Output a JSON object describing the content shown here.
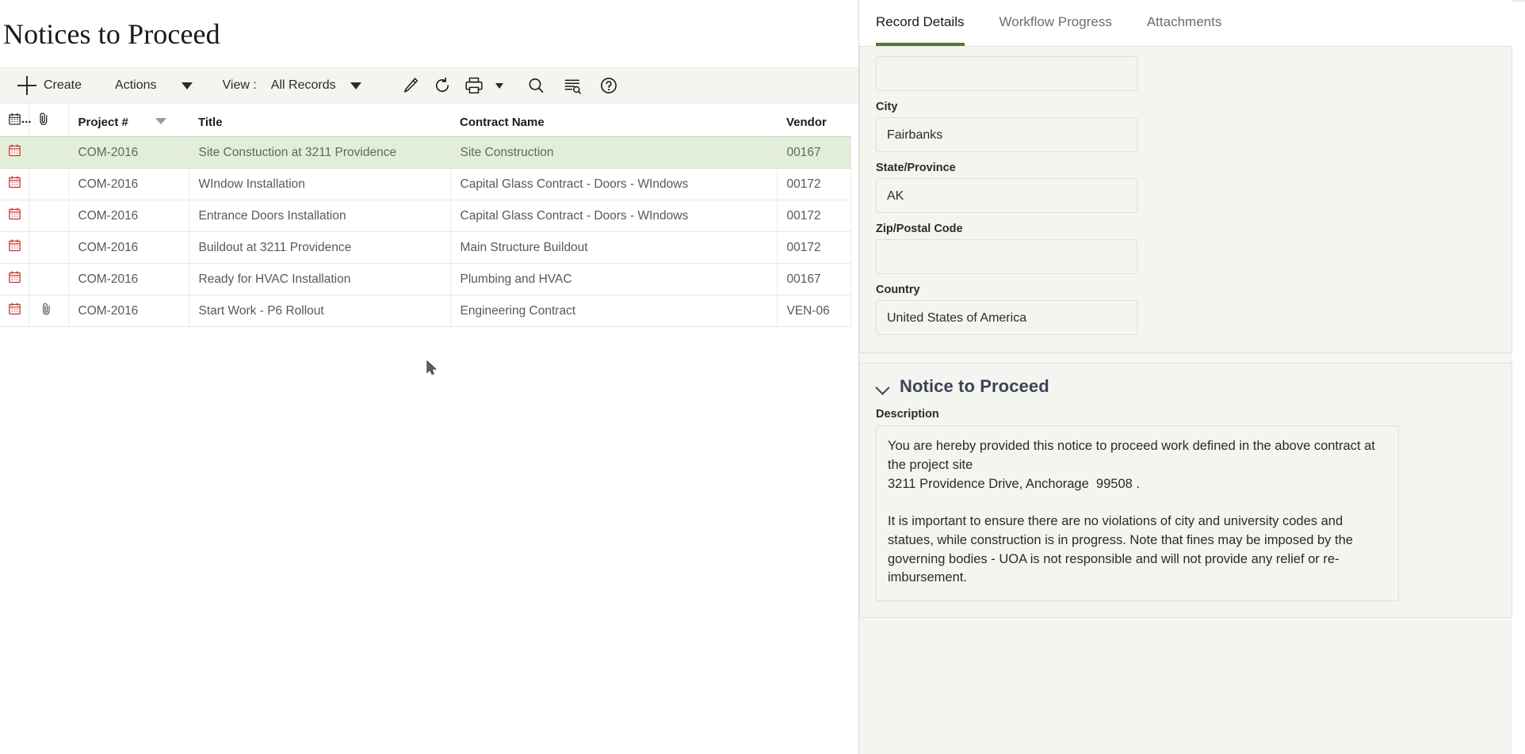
{
  "page": {
    "title": "Notices to Proceed"
  },
  "toolbar": {
    "create_label": "Create",
    "actions_label": "Actions",
    "view_label": "View :",
    "view_value": "All Records",
    "icons": {
      "create": "plus-icon",
      "actions_caret": "caret-down-icon",
      "view_caret": "caret-down-icon",
      "edit": "pencil-icon",
      "refresh": "refresh-icon",
      "print": "printer-icon",
      "print_caret": "caret-down-icon",
      "search": "search-icon",
      "advanced_search": "list-search-icon",
      "help": "question-circle-icon"
    }
  },
  "grid": {
    "columns": [
      {
        "key": "cal",
        "label": "",
        "icon": "calendar-icon"
      },
      {
        "key": "clip",
        "label": "",
        "icon": "paperclip-icon"
      },
      {
        "key": "project",
        "label": "Project #",
        "sorted": true
      },
      {
        "key": "title",
        "label": "Title"
      },
      {
        "key": "contract",
        "label": "Contract Name"
      },
      {
        "key": "vendor",
        "label": "Vendor"
      }
    ],
    "calendar_header_label": "...",
    "rows": [
      {
        "selected": true,
        "calendar": true,
        "attachment": false,
        "project": "COM-2016",
        "title": "Site Constuction at 3211 Providence",
        "contract": "Site Construction",
        "vendor": "00167"
      },
      {
        "selected": false,
        "calendar": true,
        "attachment": false,
        "project": "COM-2016",
        "title": "WIndow Installation",
        "contract": "Capital Glass Contract - Doors - WIndows",
        "vendor": "00172"
      },
      {
        "selected": false,
        "calendar": true,
        "attachment": false,
        "project": "COM-2016",
        "title": "Entrance Doors Installation",
        "contract": "Capital Glass Contract - Doors - WIndows",
        "vendor": "00172"
      },
      {
        "selected": false,
        "calendar": true,
        "attachment": false,
        "project": "COM-2016",
        "title": "Buildout at 3211 Providence",
        "contract": "Main Structure Buildout",
        "vendor": "00172"
      },
      {
        "selected": false,
        "calendar": true,
        "attachment": false,
        "project": "COM-2016",
        "title": "Ready for HVAC Installation",
        "contract": "Plumbing and HVAC",
        "vendor": "00167"
      },
      {
        "selected": false,
        "calendar": true,
        "attachment": true,
        "project": "COM-2016",
        "title": "Start Work - P6 Rollout",
        "contract": "Engineering Contract",
        "vendor": "VEN-06"
      }
    ]
  },
  "details": {
    "tabs": [
      {
        "label": "Record Details",
        "active": true
      },
      {
        "label": "Workflow Progress",
        "active": false
      },
      {
        "label": "Attachments",
        "active": false
      }
    ],
    "address_fields": [
      {
        "label": "",
        "value": ""
      },
      {
        "label": "City",
        "value": "Fairbanks"
      },
      {
        "label": "State/Province",
        "value": "AK"
      },
      {
        "label": "Zip/Postal Code",
        "value": ""
      },
      {
        "label": "Country",
        "value": "United States of America"
      }
    ],
    "notice_section": {
      "title": "Notice to Proceed",
      "expanded": true,
      "description_label": "Description",
      "description_value": "You are hereby provided this notice to proceed work defined in the above contract at the project site\n3211 Providence Drive, Anchorage  99508 .\n\nIt is important to ensure there are no violations of city and university codes and statues, while construction is in progress. Note that fines may be imposed by the governing bodies - UOA is not responsible and will not provide any relief or re-imbursement."
    }
  },
  "colors": {
    "accent_green": "#4d7a3b",
    "row_selected": "#e3eed8",
    "section_title": "#3c4557",
    "toolbar_bg": "#f4f4f0",
    "calendar_icon_red": "#c3352b"
  }
}
